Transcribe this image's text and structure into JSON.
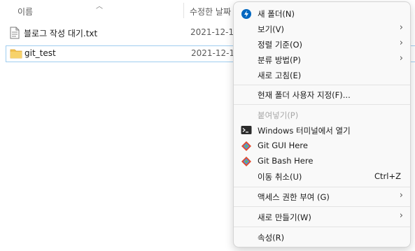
{
  "list": {
    "col_name": "이름",
    "col_date": "수정한 날짜",
    "files": [
      {
        "name": "블로그 작성 대기.txt",
        "date": "2021-12-1",
        "type": "text"
      },
      {
        "name": "git_test",
        "date": "2021-12-1",
        "type": "folder"
      }
    ]
  },
  "menu": {
    "items": [
      {
        "label": "새 폴더(N)",
        "icon": "new-folder-icon"
      },
      {
        "label": "보기(V)",
        "submenu": true
      },
      {
        "label": "정렬 기준(O)",
        "submenu": true
      },
      {
        "label": "분류 방법(P)",
        "submenu": true
      },
      {
        "label": "새로 고침(E)"
      },
      {
        "label": "현재 폴더 사용자 지정(F)..."
      },
      {
        "label": "붙여넣기(P)",
        "disabled": true
      },
      {
        "label": "Windows 터미널에서 열기",
        "icon": "terminal-icon"
      },
      {
        "label": "Git GUI Here",
        "icon": "git-icon"
      },
      {
        "label": "Git Bash Here",
        "icon": "git-icon"
      },
      {
        "label": "이동 취소(U)",
        "shortcut": "Ctrl+Z"
      },
      {
        "label": "액세스 권한 부여 (G)",
        "submenu": true
      },
      {
        "label": "새로 만들기(W)",
        "submenu": true
      },
      {
        "label": "속성(R)"
      }
    ],
    "chevron": "›"
  },
  "colors": {
    "accent": "#0067c0",
    "selection_border": "#9fcdf0",
    "folder": "#f2c14e"
  }
}
